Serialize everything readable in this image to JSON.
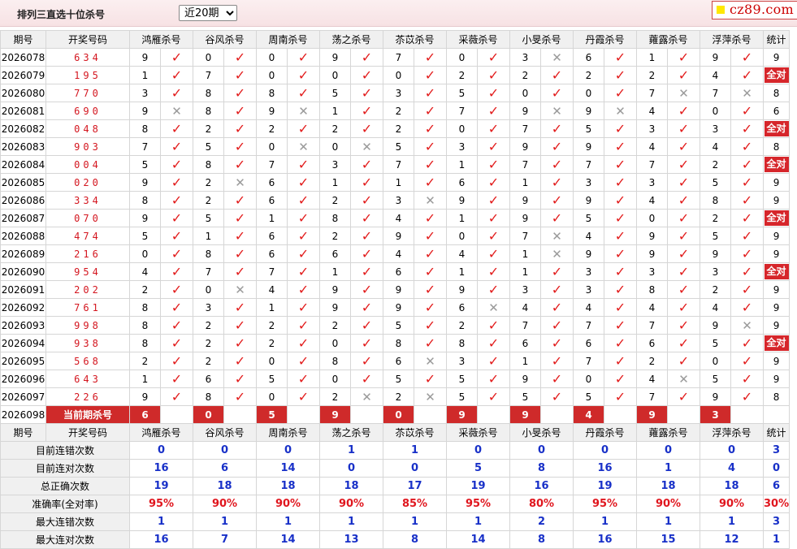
{
  "header": {
    "title": "排列三直选十位杀号",
    "range_selected": "近20期",
    "logo": "cz89.com"
  },
  "columns": {
    "period": "期号",
    "draw": "开奖号码",
    "experts": [
      "鸿雁杀号",
      "谷风杀号",
      "周南杀号",
      "荡之杀号",
      "苶苡杀号",
      "采薇杀号",
      "小旻杀号",
      "丹霞杀号",
      "蕹露杀号",
      "浮萍杀号"
    ],
    "stat": "统计"
  },
  "rows": [
    {
      "period": "2026078",
      "draw": "634",
      "kills": [
        9,
        0,
        0,
        9,
        7,
        0,
        3,
        6,
        1,
        9
      ],
      "ok": [
        1,
        1,
        1,
        1,
        1,
        1,
        0,
        1,
        1,
        1
      ],
      "stat": "9"
    },
    {
      "period": "2026079",
      "draw": "195",
      "kills": [
        1,
        7,
        0,
        0,
        0,
        2,
        2,
        2,
        2,
        4
      ],
      "ok": [
        1,
        1,
        1,
        1,
        1,
        1,
        1,
        1,
        1,
        1
      ],
      "stat": "全对"
    },
    {
      "period": "2026080",
      "draw": "770",
      "kills": [
        3,
        8,
        8,
        5,
        3,
        5,
        0,
        0,
        7,
        7
      ],
      "ok": [
        1,
        1,
        1,
        1,
        1,
        1,
        1,
        1,
        0,
        0
      ],
      "stat": "8"
    },
    {
      "period": "2026081",
      "draw": "690",
      "kills": [
        9,
        8,
        9,
        1,
        2,
        7,
        9,
        9,
        4,
        0
      ],
      "ok": [
        0,
        1,
        0,
        1,
        1,
        1,
        0,
        0,
        1,
        1
      ],
      "stat": "6"
    },
    {
      "period": "2026082",
      "draw": "048",
      "kills": [
        8,
        2,
        2,
        2,
        2,
        0,
        7,
        5,
        3,
        3
      ],
      "ok": [
        1,
        1,
        1,
        1,
        1,
        1,
        1,
        1,
        1,
        1
      ],
      "stat": "全对"
    },
    {
      "period": "2026083",
      "draw": "903",
      "kills": [
        7,
        5,
        0,
        0,
        5,
        3,
        9,
        9,
        4,
        4
      ],
      "ok": [
        1,
        1,
        0,
        0,
        1,
        1,
        1,
        1,
        1,
        1
      ],
      "stat": "8"
    },
    {
      "period": "2026084",
      "draw": "004",
      "kills": [
        5,
        8,
        7,
        3,
        7,
        1,
        7,
        7,
        7,
        2
      ],
      "ok": [
        1,
        1,
        1,
        1,
        1,
        1,
        1,
        1,
        1,
        1
      ],
      "stat": "全对"
    },
    {
      "period": "2026085",
      "draw": "020",
      "kills": [
        9,
        2,
        6,
        1,
        1,
        6,
        1,
        3,
        3,
        5
      ],
      "ok": [
        1,
        0,
        1,
        1,
        1,
        1,
        1,
        1,
        1,
        1
      ],
      "stat": "9"
    },
    {
      "period": "2026086",
      "draw": "334",
      "kills": [
        8,
        2,
        6,
        2,
        3,
        9,
        9,
        9,
        4,
        8
      ],
      "ok": [
        1,
        1,
        1,
        1,
        0,
        1,
        1,
        1,
        1,
        1
      ],
      "stat": "9"
    },
    {
      "period": "2026087",
      "draw": "070",
      "kills": [
        9,
        5,
        1,
        8,
        4,
        1,
        9,
        5,
        0,
        2
      ],
      "ok": [
        1,
        1,
        1,
        1,
        1,
        1,
        1,
        1,
        1,
        1
      ],
      "stat": "全对"
    },
    {
      "period": "2026088",
      "draw": "474",
      "kills": [
        5,
        1,
        6,
        2,
        9,
        0,
        7,
        4,
        9,
        5
      ],
      "ok": [
        1,
        1,
        1,
        1,
        1,
        1,
        0,
        1,
        1,
        1
      ],
      "stat": "9"
    },
    {
      "period": "2026089",
      "draw": "216",
      "kills": [
        0,
        8,
        6,
        6,
        4,
        4,
        1,
        9,
        9,
        9
      ],
      "ok": [
        1,
        1,
        1,
        1,
        1,
        1,
        0,
        1,
        1,
        1
      ],
      "stat": "9"
    },
    {
      "period": "2026090",
      "draw": "954",
      "kills": [
        4,
        7,
        7,
        1,
        6,
        1,
        1,
        3,
        3,
        3
      ],
      "ok": [
        1,
        1,
        1,
        1,
        1,
        1,
        1,
        1,
        1,
        1
      ],
      "stat": "全对"
    },
    {
      "period": "2026091",
      "draw": "202",
      "kills": [
        2,
        0,
        4,
        9,
        9,
        9,
        3,
        3,
        8,
        2
      ],
      "ok": [
        1,
        0,
        1,
        1,
        1,
        1,
        1,
        1,
        1,
        1
      ],
      "stat": "9"
    },
    {
      "period": "2026092",
      "draw": "761",
      "kills": [
        8,
        3,
        1,
        9,
        9,
        6,
        4,
        4,
        4,
        4
      ],
      "ok": [
        1,
        1,
        1,
        1,
        1,
        0,
        1,
        1,
        1,
        1
      ],
      "stat": "9"
    },
    {
      "period": "2026093",
      "draw": "998",
      "kills": [
        8,
        2,
        2,
        2,
        5,
        2,
        7,
        7,
        7,
        9
      ],
      "ok": [
        1,
        1,
        1,
        1,
        1,
        1,
        1,
        1,
        1,
        0
      ],
      "stat": "9"
    },
    {
      "period": "2026094",
      "draw": "938",
      "kills": [
        8,
        2,
        2,
        0,
        8,
        8,
        6,
        6,
        6,
        5
      ],
      "ok": [
        1,
        1,
        1,
        1,
        1,
        1,
        1,
        1,
        1,
        1
      ],
      "stat": "全对"
    },
    {
      "period": "2026095",
      "draw": "568",
      "kills": [
        2,
        2,
        0,
        8,
        6,
        3,
        1,
        7,
        2,
        0
      ],
      "ok": [
        1,
        1,
        1,
        1,
        0,
        1,
        1,
        1,
        1,
        1
      ],
      "stat": "9"
    },
    {
      "period": "2026096",
      "draw": "643",
      "kills": [
        1,
        6,
        5,
        0,
        5,
        5,
        9,
        0,
        4,
        5
      ],
      "ok": [
        1,
        1,
        1,
        1,
        1,
        1,
        1,
        1,
        0,
        1
      ],
      "stat": "9"
    },
    {
      "period": "2026097",
      "draw": "226",
      "kills": [
        9,
        8,
        0,
        2,
        2,
        5,
        5,
        5,
        7,
        9
      ],
      "ok": [
        1,
        1,
        1,
        0,
        0,
        1,
        1,
        1,
        1,
        1
      ],
      "stat": "8"
    }
  ],
  "current": {
    "period": "2026098",
    "label": "当前期杀号",
    "kills": [
      "6",
      "0",
      "5",
      "9",
      "0",
      "9",
      "9",
      "4",
      "9",
      "3"
    ]
  },
  "summary_rows": [
    {
      "label": "目前连错次数",
      "values": [
        "0",
        "0",
        "0",
        "1",
        "1",
        "0",
        "0",
        "0",
        "0",
        "0"
      ],
      "stat": "3",
      "red": false
    },
    {
      "label": "目前连对次数",
      "values": [
        "16",
        "6",
        "14",
        "0",
        "0",
        "5",
        "8",
        "16",
        "1",
        "4"
      ],
      "stat": "0",
      "red": false
    },
    {
      "label": "总正确次数",
      "values": [
        "19",
        "18",
        "18",
        "18",
        "17",
        "19",
        "16",
        "19",
        "18",
        "18"
      ],
      "stat": "6",
      "red": false
    },
    {
      "label": "准确率(全对率)",
      "values": [
        "95%",
        "90%",
        "90%",
        "90%",
        "85%",
        "95%",
        "80%",
        "95%",
        "90%",
        "90%"
      ],
      "stat": "30%",
      "red": true
    },
    {
      "label": "最大连错次数",
      "values": [
        "1",
        "1",
        "1",
        "1",
        "1",
        "1",
        "2",
        "1",
        "1",
        "1"
      ],
      "stat": "3",
      "red": false
    },
    {
      "label": "最大连对次数",
      "values": [
        "16",
        "7",
        "14",
        "13",
        "8",
        "14",
        "8",
        "16",
        "15",
        "12"
      ],
      "stat": "1",
      "red": false
    }
  ],
  "marks": {
    "ok": "✓",
    "bad": "✕"
  },
  "colors": {
    "accent": "#d6262b",
    "ok": "#e21b1b",
    "bad": "#9a9a9a",
    "summary_blue": "#1830c8"
  }
}
